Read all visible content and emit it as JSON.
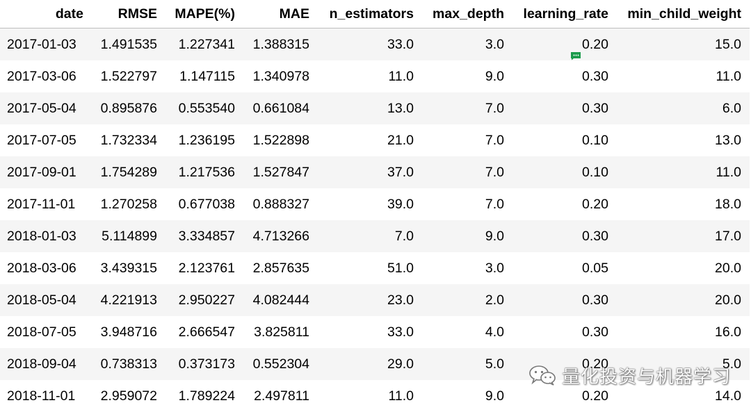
{
  "table": {
    "columns": [
      "date",
      "RMSE",
      "MAPE(%)",
      "MAE",
      "n_estimators",
      "max_depth",
      "learning_rate",
      "min_child_weight"
    ],
    "rows": [
      [
        "2017-01-03",
        "1.491535",
        "1.227341",
        "1.388315",
        "33.0",
        "3.0",
        "0.20",
        "15.0"
      ],
      [
        "2017-03-06",
        "1.522797",
        "1.147115",
        "1.340978",
        "11.0",
        "9.0",
        "0.30",
        "11.0"
      ],
      [
        "2017-05-04",
        "0.895876",
        "0.553540",
        "0.661084",
        "13.0",
        "7.0",
        "0.30",
        "6.0"
      ],
      [
        "2017-07-05",
        "1.732334",
        "1.236195",
        "1.522898",
        "21.0",
        "7.0",
        "0.10",
        "13.0"
      ],
      [
        "2017-09-01",
        "1.754289",
        "1.217536",
        "1.527847",
        "37.0",
        "7.0",
        "0.10",
        "11.0"
      ],
      [
        "2017-11-01",
        "1.270258",
        "0.677038",
        "0.888327",
        "39.0",
        "7.0",
        "0.20",
        "18.0"
      ],
      [
        "2018-01-03",
        "5.114899",
        "3.334857",
        "4.713266",
        "7.0",
        "9.0",
        "0.30",
        "17.0"
      ],
      [
        "2018-03-06",
        "3.439315",
        "2.123761",
        "2.857635",
        "51.0",
        "3.0",
        "0.05",
        "20.0"
      ],
      [
        "2018-05-04",
        "4.221913",
        "2.950227",
        "4.082444",
        "23.0",
        "2.0",
        "0.30",
        "20.0"
      ],
      [
        "2018-07-05",
        "3.948716",
        "2.666547",
        "3.825811",
        "33.0",
        "4.0",
        "0.30",
        "16.0"
      ],
      [
        "2018-09-04",
        "0.738313",
        "0.373173",
        "0.552304",
        "29.0",
        "5.0",
        "0.20",
        "5.0"
      ],
      [
        "2018-11-01",
        "2.959072",
        "1.789224",
        "2.497811",
        "11.0",
        "9.0",
        "0.20",
        "14.0"
      ]
    ]
  },
  "watermark": {
    "text": "量化投资与机器学习",
    "icon": "wechat-icon"
  },
  "comment_flag": {
    "icon": "comment-flag-icon",
    "color": "#1a9b4b"
  },
  "colors": {
    "stripe": "#f5f5f5",
    "header_border": "#bdbdbd"
  }
}
